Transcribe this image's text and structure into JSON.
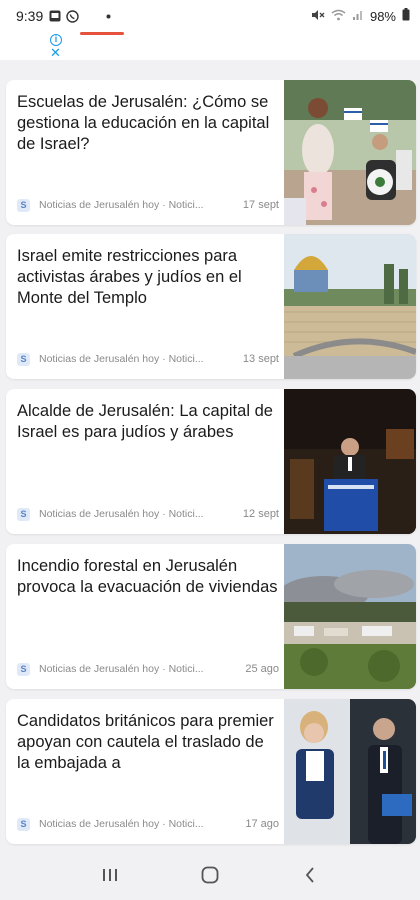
{
  "status_bar": {
    "time": "9:39",
    "battery": "98%",
    "icons": [
      "gallery-icon",
      "whatsapp-icon",
      "mute-icon",
      "wifi-icon",
      "signal-icon",
      "battery-icon"
    ]
  },
  "ad": {
    "info_icon": "info-icon",
    "close_icon": "close-icon",
    "accent_color": "#1a9be8"
  },
  "articles": [
    {
      "title": "Escuelas de Jerusalén: ¿Cómo se gestiona la educación en la capital de Israel?",
      "source": "Noticias de Jerusalén hoy · Notici...",
      "date": "17 sept",
      "image": "schoolchildren-with-flags"
    },
    {
      "title": "Israel emite restricciones para activistas árabes y judíos en el Monte del Templo",
      "source": "Noticias de Jerusalén hoy · Notici...",
      "date": "13 sept",
      "image": "dome-of-the-rock-western-wall"
    },
    {
      "title": "Alcalde de Jerusalén: La capital de Israel es para judíos y árabes",
      "source": "Noticias de Jerusalén hoy · Notici...",
      "date": "12 sept",
      "image": "mayor-at-podium"
    },
    {
      "title": "Incendio forestal en Jerusalén provoca la evacuación de viviendas",
      "source": "Noticias de Jerusalén hoy · Notici...",
      "date": "25 ago",
      "image": "forest-fire-smoke-over-city"
    },
    {
      "title": "Candidatos británicos para premier apoyan con cautela el traslado de la embajada a",
      "source": "Noticias de Jerusalén hoy · Notici...",
      "date": "17 ago",
      "image": "british-candidates-portraits"
    }
  ],
  "nav_bar": {
    "recents_icon": "recents-icon",
    "home_icon": "home-icon",
    "back_icon": "back-icon"
  }
}
